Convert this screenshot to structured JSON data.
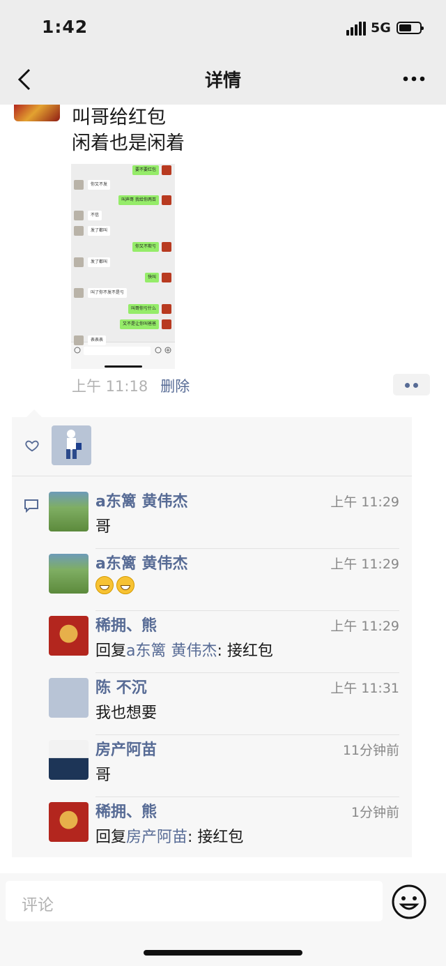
{
  "status": {
    "time": "1:42",
    "network": "5G",
    "battery_level": 0.6
  },
  "nav": {
    "title": "详情",
    "back_icon": "chevron-left-icon",
    "more_icon": "more-dots-icon"
  },
  "post": {
    "line1": "叫哥给红包",
    "line2": "闲着也是闲着",
    "time": "上午 11:18",
    "delete_label": "删除",
    "screenshot": {
      "messages": [
        {
          "side": "right",
          "text": "要不要红包"
        },
        {
          "side": "left",
          "text": "你又不发"
        },
        {
          "side": "right",
          "text": "叫声哥 我给你两百"
        },
        {
          "side": "left",
          "text": "不信"
        },
        {
          "side": "left",
          "text": "发了都叫"
        },
        {
          "side": "right",
          "text": "你又不欺亏"
        },
        {
          "side": "left",
          "text": "发了都叫"
        },
        {
          "side": "right",
          "text": "快叫"
        },
        {
          "side": "left",
          "text": "叫了你不发不是亏"
        },
        {
          "side": "right",
          "text": "叫哥你亏什么"
        },
        {
          "side": "right",
          "text": "又不是让你叫爸爸"
        },
        {
          "side": "left",
          "text": "表表表"
        }
      ]
    }
  },
  "interactions": {
    "like_icon": "heart-icon",
    "comment_icon": "comment-icon",
    "comments": [
      {
        "name": "a东篱  黄伟杰",
        "time": "上午 11:29",
        "text": "哥",
        "avatar": "landscape"
      },
      {
        "name": "a东篱  黄伟杰",
        "time": "上午 11:29",
        "text": "",
        "emoji": [
          "grin-emoji",
          "grin-emoji"
        ],
        "avatar": "landscape"
      },
      {
        "name": "稀拥、熊",
        "time": "上午 11:29",
        "reply_prefix": "回复",
        "reply_to": "a东篱  黄伟杰",
        "text": ": 接红包",
        "avatar": "tiger"
      },
      {
        "name": "陈  不沉",
        "time": "上午 11:31",
        "text": "我也想要",
        "avatar": "boy"
      },
      {
        "name": "房产阿苗",
        "time": "11分钟前",
        "text": "哥",
        "avatar": "man"
      },
      {
        "name": "稀拥、熊",
        "time": "1分钟前",
        "reply_prefix": "回复",
        "reply_to": "房产阿苗",
        "text": ": 接红包",
        "avatar": "tiger"
      }
    ]
  },
  "input": {
    "placeholder": "评论",
    "emoji_icon": "smiley-icon"
  }
}
